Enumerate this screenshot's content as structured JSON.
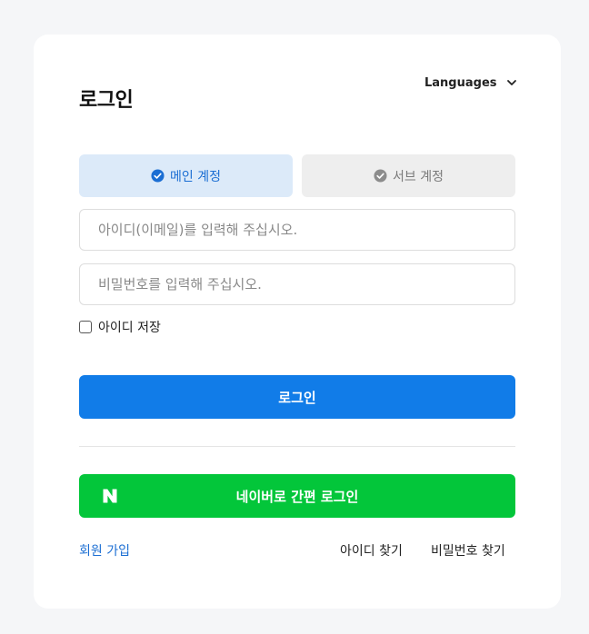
{
  "title": "로그인",
  "language_selector": {
    "label": "Languages"
  },
  "tabs": [
    {
      "label": "메인 계정",
      "active": true
    },
    {
      "label": "서브 계정",
      "active": false
    }
  ],
  "inputs": {
    "id_placeholder": "아이디(이메일)를 입력해 주십시오.",
    "password_placeholder": "비밀번호를 입력해 주십시오."
  },
  "remember_id_label": "아이디 저장",
  "login_button_label": "로그인",
  "naver_button_label": "네이버로 간편 로그인",
  "links": {
    "signup": "회원 가입",
    "find_id": "아이디 찾기",
    "find_password": "비밀번호 찾기"
  },
  "colors": {
    "primary": "#117ce8",
    "naver_green": "#03c63a",
    "active_tab_bg": "#dceaf9",
    "inactive_tab_bg": "#eeeeee"
  },
  "icons": {
    "language_chevron": "chevron-down-icon",
    "tab_check": "check-circle-icon",
    "naver_logo": "naver-n-logo"
  }
}
